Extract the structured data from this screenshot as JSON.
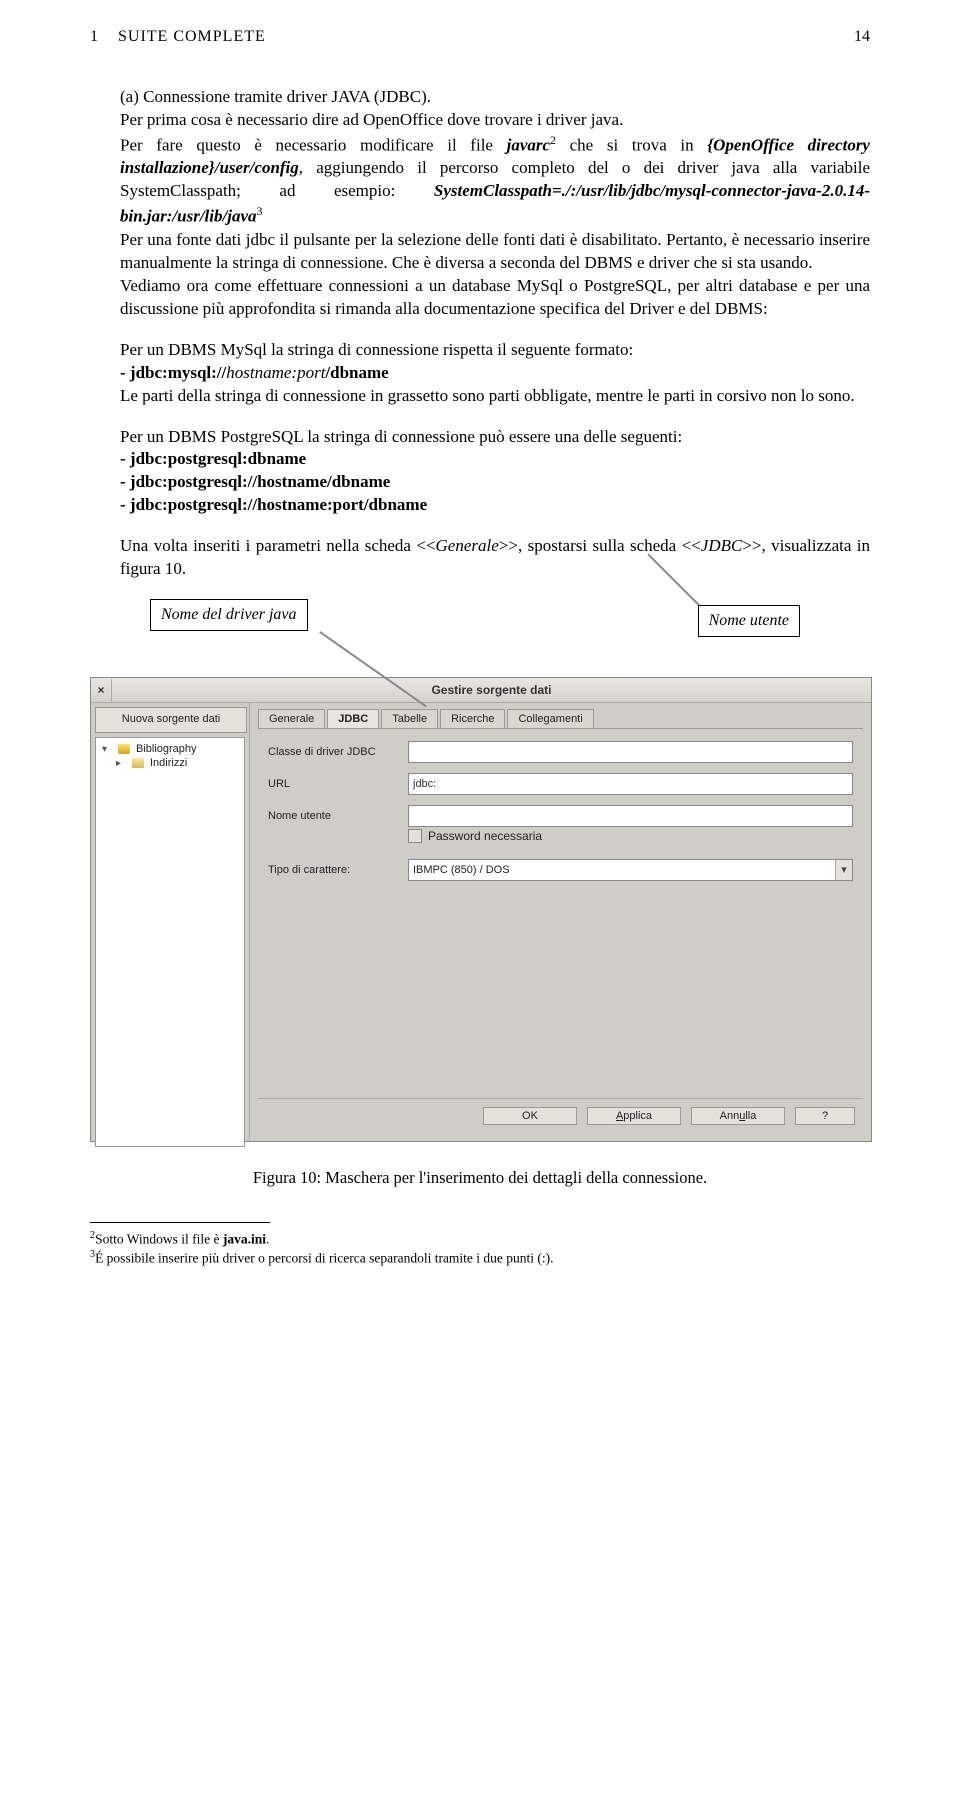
{
  "header": {
    "left_num": "1",
    "left_text": "SUITE COMPLETE",
    "right_num": "14"
  },
  "content": {
    "a_label": "(a)",
    "a_sentence1": " Connessione tramite driver JAVA (JDBC).",
    "a_sentence2_part1": "Per prima cosa è necessario dire ad OpenOffice dove trovare i driver java.",
    "a_sentence3_prefix": "Per fare questo è necessario modificare il file ",
    "a_sentence3_file": "javarc",
    "a_sentence3_fn": "2",
    "a_sentence3_mid1": " che si trova in ",
    "a_sentence3_path": "{OpenOffice directory installazione}/user/config",
    "a_sentence3_mid2": ", aggiungendo il percorso completo del o dei driver java alla variabile SystemClasspath; ad esempio: ",
    "a_sentence3_example": "SystemClasspath=./:/usr/lib/jdbc/mysql-connector-java-2.0.14-bin.jar:/usr/lib/java",
    "a_sentence3_fn2": "3",
    "a_sentence4": "Per una fonte dati jdbc il pulsante per la selezione delle fonti dati è disabilitato. Pertanto, è necessario inserire manualmente la stringa di connessione. Che è diversa a seconda del DBMS e driver che si sta usando.",
    "a_sentence5": "Vediamo ora come effettuare connessioni a un database MySql o PostgreSQL, per altri database e per una discussione più approfondita si rimanda alla documentazione specifica del Driver e del DBMS:",
    "mysql_intro": "Per un DBMS MySql la stringa di connessione rispetta il seguente formato:",
    "mysql_fmt_prefix": "- jdbc:mysql://",
    "mysql_fmt_mid": "hostname:port",
    "mysql_fmt_suffix": "/dbname",
    "mysql_note": "Le parti della stringa di connessione in grassetto sono parti obbligate, mentre le parti in corsivo non lo sono.",
    "pg_intro": "Per un DBMS PostgreSQL la stringa di connessione può essere una delle seguenti:",
    "pg_line1": "- jdbc:postgresql:dbname",
    "pg_line2": "- jdbc:postgresql://hostname/dbname",
    "pg_line3": "- jdbc:postgresql://hostname:port/dbname",
    "final_para_prefix": "Una volta inseriti i parametri nella scheda <<",
    "final_para_gen": "Generale",
    "final_para_mid": ">>, spostarsi sulla scheda <<",
    "final_para_jdbc": "JDBC",
    "final_para_suffix": ">>, visualizzata in figura 10."
  },
  "callouts": {
    "left": "Nome del driver java",
    "right": "Nome utente"
  },
  "dialog": {
    "title": "Gestire sorgente dati",
    "new_source": "Nuova sorgente dati",
    "tree": {
      "item1": "Bibliography",
      "item2": "Indirizzi"
    },
    "tabs": [
      "Generale",
      "JDBC",
      "Tabelle",
      "Ricerche",
      "Collegamenti"
    ],
    "active_tab": "JDBC",
    "form": {
      "class_label": "Classe di driver JDBC",
      "class_value": "",
      "url_label": "URL",
      "url_value": "jdbc:",
      "user_label": "Nome utente",
      "user_value": "",
      "pw_label": "Password necessaria",
      "charset_label": "Tipo di carattere:",
      "charset_value": "IBMPC (850) / DOS"
    },
    "buttons": {
      "ok": "OK",
      "apply": "Applica",
      "cancel": "Annulla",
      "help": "?"
    }
  },
  "figure_caption": "Figura 10: Maschera per l'inserimento dei dettagli della connessione.",
  "footnotes": {
    "f2_num": "2",
    "f2_text_prefix": "Sotto Windows il file è ",
    "f2_text_bold": "java.ini",
    "f2_text_suffix": ".",
    "f3_num": "3",
    "f3_text": "É possibile inserire più driver o percorsi di ricerca separandoli tramite i due punti (:)."
  }
}
